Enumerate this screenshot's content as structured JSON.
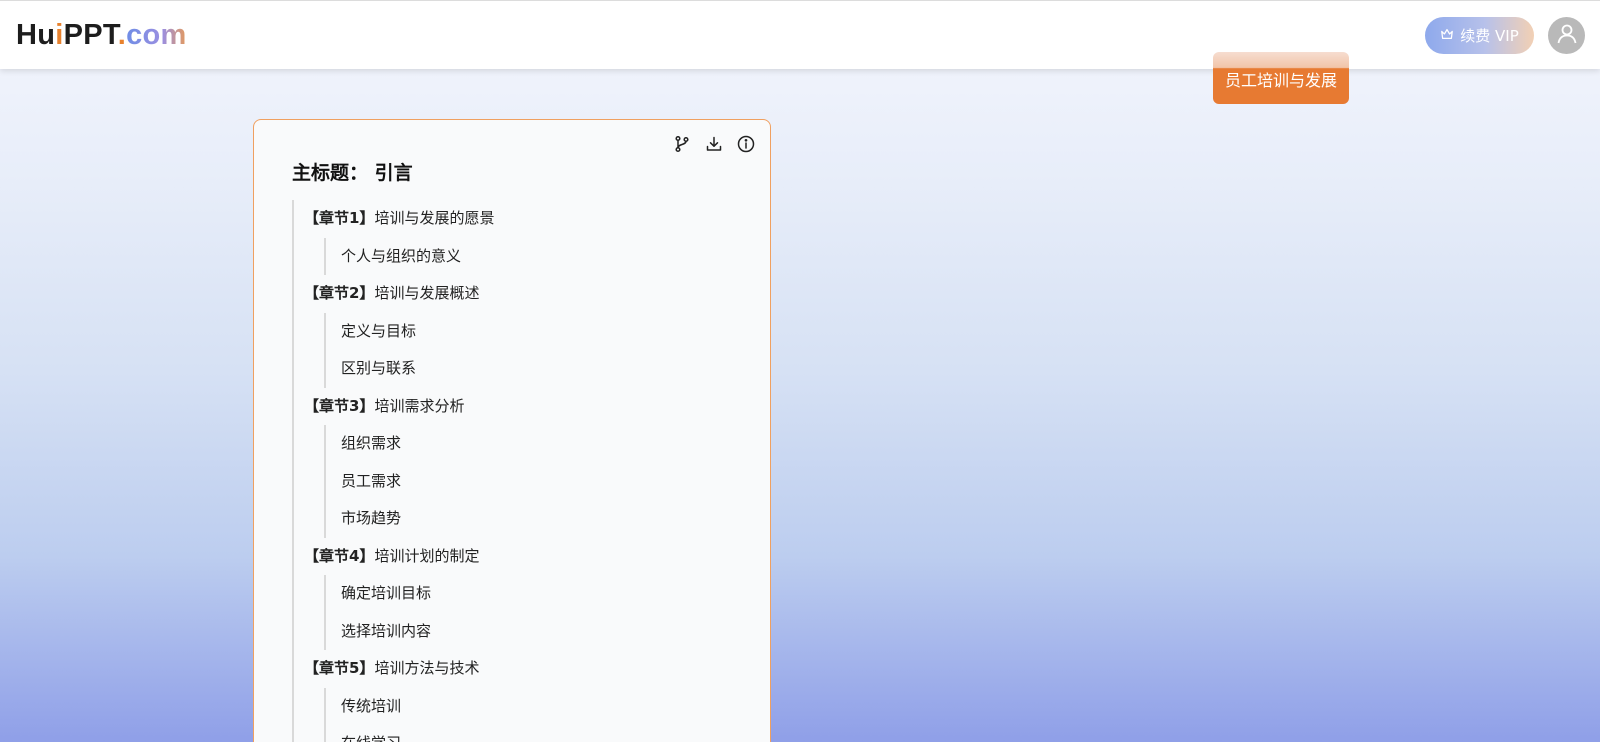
{
  "header": {
    "logo": {
      "hu": "Hu",
      "i": "i",
      "ppt": "PPT",
      "dot": ".",
      "com": "com"
    },
    "vip_button": "续费 VIP",
    "avatar_icon": "user-icon"
  },
  "floating_tag": "员工培训与发展",
  "outline_card": {
    "toolbar_icons": [
      "branch-icon",
      "download-icon",
      "info-icon"
    ],
    "main_title": "主标题： 引言",
    "chapters": [
      {
        "tag": "【章节1】",
        "title": "培训与发展的愿景",
        "subs": [
          "个人与组织的意义"
        ]
      },
      {
        "tag": "【章节2】",
        "title": "培训与发展概述",
        "subs": [
          "定义与目标",
          "区别与联系"
        ]
      },
      {
        "tag": "【章节3】",
        "title": "培训需求分析",
        "subs": [
          "组织需求",
          "员工需求",
          "市场趋势"
        ]
      },
      {
        "tag": "【章节4】",
        "title": "培训计划的制定",
        "subs": [
          "确定培训目标",
          "选择培训内容"
        ]
      },
      {
        "tag": "【章节5】",
        "title": "培训方法与技术",
        "subs": [
          "传统培训",
          "在线学习"
        ]
      }
    ]
  },
  "colors": {
    "accent": "#e77a32",
    "card_border": "#f0a060",
    "vip_gradient_start": "#8ea9ec",
    "vip_gradient_end": "#f2d0b4"
  }
}
